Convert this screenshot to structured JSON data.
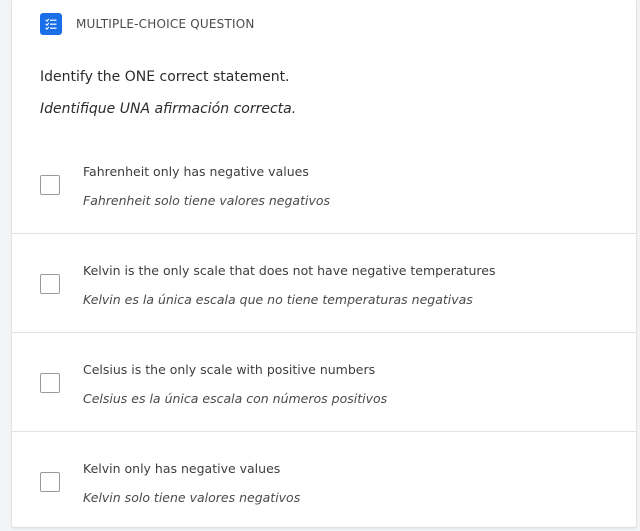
{
  "header": {
    "icon": "checklist-icon",
    "type_label": "MULTIPLE-CHOICE QUESTION"
  },
  "question": {
    "text_en": "Identify the ONE correct statement.",
    "text_es": "Identifique UNA afirmación correcta."
  },
  "options": [
    {
      "text_en": "Fahrenheit only has negative values",
      "text_es": "Fahrenheit solo tiene valores negativos",
      "checked": false
    },
    {
      "text_en": "Kelvin is the only scale that does not have negative temperatures",
      "text_es": "Kelvin es la única escala que no tiene temperaturas negativas",
      "checked": false
    },
    {
      "text_en": "Celsius is the only scale with positive numbers",
      "text_es": "Celsius es la única escala con números positivos",
      "checked": false
    },
    {
      "text_en": "Kelvin only has negative values",
      "text_es": "Kelvin solo tiene valores negativos",
      "checked": false
    }
  ],
  "colors": {
    "accent": "#1a6fe8",
    "card_background": "#ffffff",
    "page_background": "#f3f4f6",
    "divider": "#e2e2e2"
  }
}
